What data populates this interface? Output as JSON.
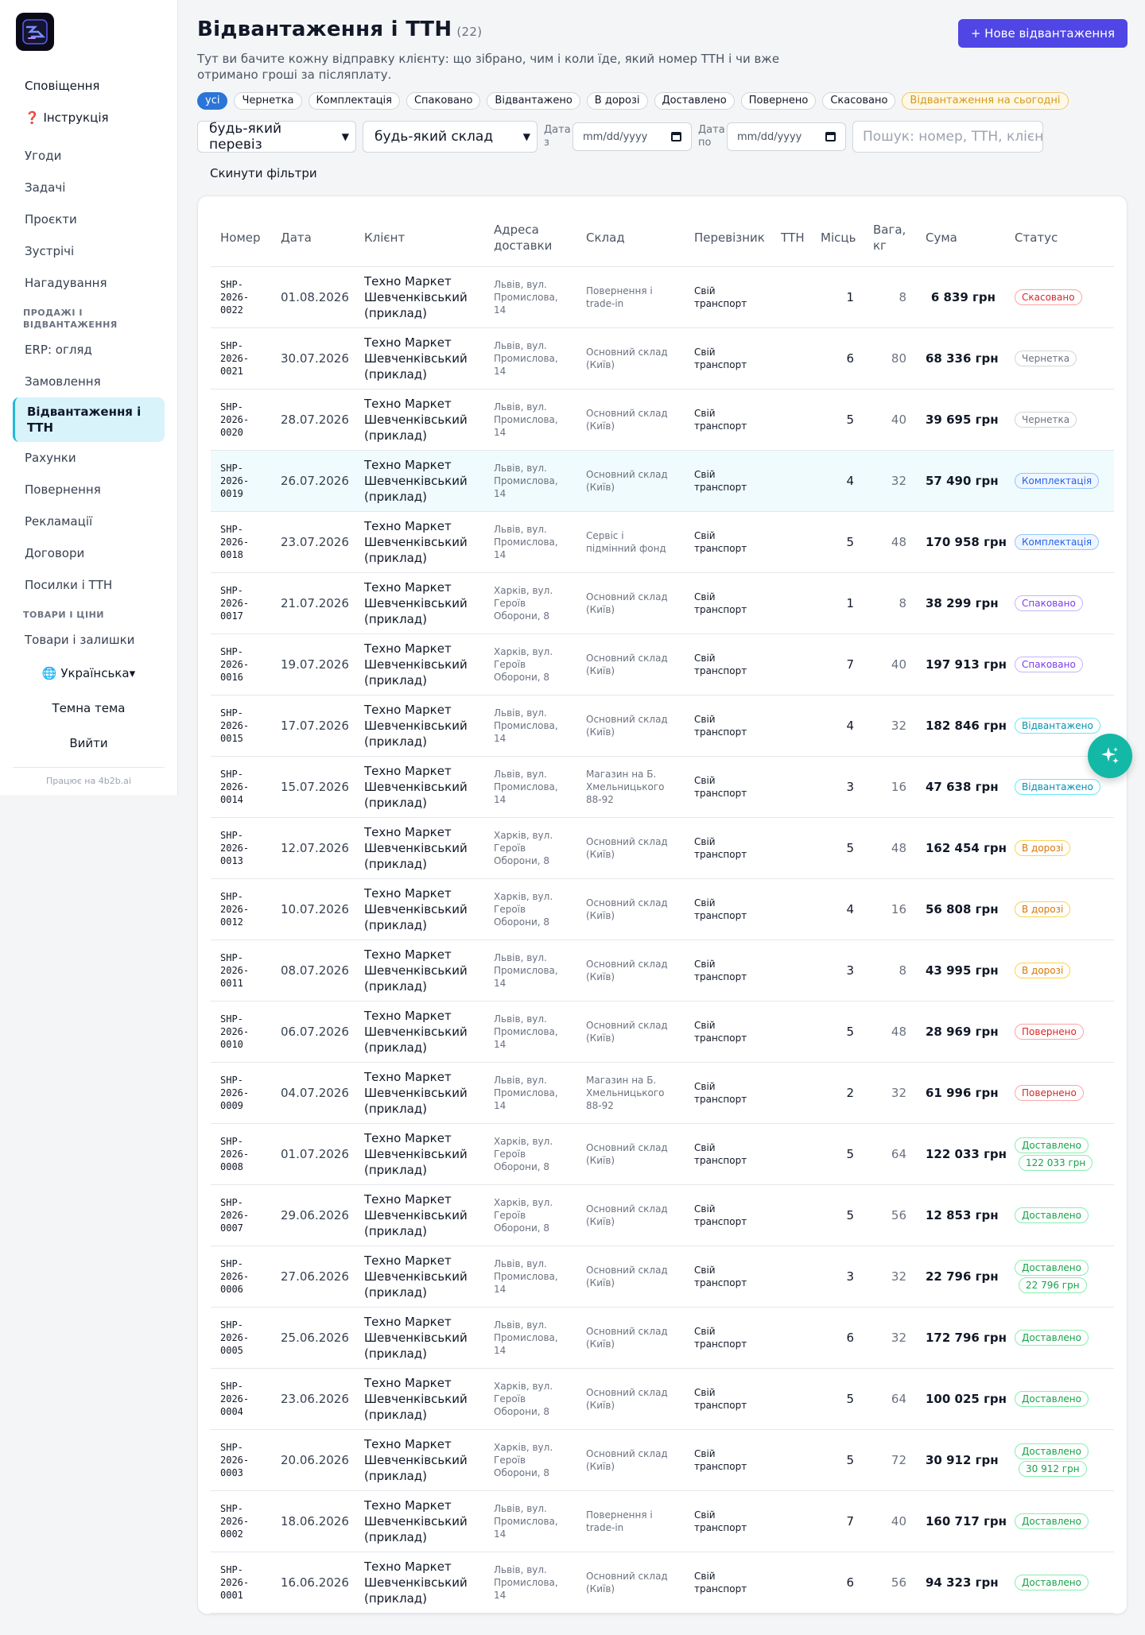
{
  "sidebar": {
    "top": [
      {
        "id": "notifications",
        "label": "Сповіщення"
      },
      {
        "id": "instructions",
        "label": "❓ Інструкція"
      }
    ],
    "main": [
      {
        "id": "deals",
        "label": "Угоди"
      },
      {
        "id": "tasks",
        "label": "Задачі"
      },
      {
        "id": "projects",
        "label": "Проєкти"
      },
      {
        "id": "meetings",
        "label": "Зустрічі"
      },
      {
        "id": "reminders",
        "label": "Нагадування"
      }
    ],
    "sales_section": "ПРОДАЖІ І ВІДВАНТАЖЕННЯ",
    "sales": [
      {
        "id": "erp",
        "label": "ERP: огляд"
      },
      {
        "id": "orders",
        "label": "Замовлення"
      },
      {
        "id": "shipments",
        "label": "Відвантаження і ТТН"
      },
      {
        "id": "invoices",
        "label": "Рахунки"
      },
      {
        "id": "returns",
        "label": "Повернення"
      },
      {
        "id": "claims",
        "label": "Рекламації"
      },
      {
        "id": "contracts",
        "label": "Договори"
      },
      {
        "id": "parcels",
        "label": "Посилки і ТТН"
      }
    ],
    "goods_section": "ТОВАРИ І ЦІНИ",
    "goods": [
      {
        "id": "stock",
        "label": "Товари і залишки"
      }
    ],
    "language": "🌐 Українська▾",
    "theme": "Темна тема",
    "logout": "Вийти",
    "powered": "Працює на 4b2b.ai"
  },
  "header": {
    "title": "Відвантаження і ТТН",
    "count": "(22)",
    "new_button": "+ Нове відвантаження",
    "subtitle": "Тут ви бачите кожну відправку клієнту: що зібрано, чим і коли їде, який номер ТТН і чи вже отримано гроші за післяплату."
  },
  "status_chips": [
    {
      "label": "усі",
      "state": "active"
    },
    {
      "label": "Чернетка",
      "state": ""
    },
    {
      "label": "Комплектація",
      "state": ""
    },
    {
      "label": "Спаковано",
      "state": ""
    },
    {
      "label": "Відвантажено",
      "state": ""
    },
    {
      "label": "В дорозі",
      "state": ""
    },
    {
      "label": "Доставлено",
      "state": ""
    },
    {
      "label": "Повернено",
      "state": ""
    },
    {
      "label": "Скасовано",
      "state": ""
    },
    {
      "label": "Відвантаження на сьогодні",
      "state": "today"
    }
  ],
  "filters": {
    "carrier": "будь-який перевіз",
    "warehouse": "будь-який склад",
    "date_from_label": "Дата з",
    "date_to_label": "Дата по",
    "date_placeholder": "mm/dd/yyyy",
    "search_placeholder": "Пошук: номер, ТТН, клієн",
    "reset": "Скинути фільтри"
  },
  "table": {
    "columns": {
      "number": "Номер",
      "date": "Дата",
      "client": "Клієнт",
      "address": "Адреса доставки",
      "warehouse": "Склад",
      "carrier": "Перевізник",
      "ttn": "ТТН",
      "places": "Місць",
      "weight": "Вага, кг",
      "sum": "Сума",
      "status": "Статус"
    },
    "rows": [
      {
        "number": "SHP-2026-0022",
        "date": "01.08.2026",
        "client": "Техно Маркет Шевченківський (приклад)",
        "address": "Львів, вул. Промислова, 14",
        "warehouse": "Повернення і trade-in",
        "carrier": "Свій транспорт",
        "ttn": "",
        "places": "1",
        "weight": "8",
        "sum": "6 839 грн",
        "status": "Скасовано",
        "status_class": "st-canceled",
        "cod": ""
      },
      {
        "number": "SHP-2026-0021",
        "date": "30.07.2026",
        "client": "Техно Маркет Шевченківський (приклад)",
        "address": "Львів, вул. Промислова, 14",
        "warehouse": "Основний склад (Київ)",
        "carrier": "Свій транспорт",
        "ttn": "",
        "places": "6",
        "weight": "80",
        "sum": "68 336 грн",
        "status": "Чернетка",
        "status_class": "st-draft",
        "cod": ""
      },
      {
        "number": "SHP-2026-0020",
        "date": "28.07.2026",
        "client": "Техно Маркет Шевченківський (приклад)",
        "address": "Львів, вул. Промислова, 14",
        "warehouse": "Основний склад (Київ)",
        "carrier": "Свій транспорт",
        "ttn": "",
        "places": "5",
        "weight": "40",
        "sum": "39 695 грн",
        "status": "Чернетка",
        "status_class": "st-draft",
        "cod": ""
      },
      {
        "number": "SHP-2026-0019",
        "date": "26.07.2026",
        "client": "Техно Маркет Шевченківський (приклад)",
        "address": "Львів, вул. Промислова, 14",
        "warehouse": "Основний склад (Київ)",
        "carrier": "Свій транспорт",
        "ttn": "",
        "places": "4",
        "weight": "32",
        "sum": "57 490 грн",
        "status": "Комплектація",
        "status_class": "st-picking",
        "cod": ""
      },
      {
        "number": "SHP-2026-0018",
        "date": "23.07.2026",
        "client": "Техно Маркет Шевченківський (приклад)",
        "address": "Львів, вул. Промислова, 14",
        "warehouse": "Сервіс і підмінний фонд",
        "carrier": "Свій транспорт",
        "ttn": "",
        "places": "5",
        "weight": "48",
        "sum": "170 958 грн",
        "status": "Комплектація",
        "status_class": "st-picking",
        "cod": ""
      },
      {
        "number": "SHP-2026-0017",
        "date": "21.07.2026",
        "client": "Техно Маркет Шевченківський (приклад)",
        "address": "Харків, вул. Героїв Оборони, 8",
        "warehouse": "Основний склад (Київ)",
        "carrier": "Свій транспорт",
        "ttn": "",
        "places": "1",
        "weight": "8",
        "sum": "38 299 грн",
        "status": "Спаковано",
        "status_class": "st-packed",
        "cod": ""
      },
      {
        "number": "SHP-2026-0016",
        "date": "19.07.2026",
        "client": "Техно Маркет Шевченківський (приклад)",
        "address": "Харків, вул. Героїв Оборони, 8",
        "warehouse": "Основний склад (Київ)",
        "carrier": "Свій транспорт",
        "ttn": "",
        "places": "7",
        "weight": "40",
        "sum": "197 913 грн",
        "status": "Спаковано",
        "status_class": "st-packed",
        "cod": ""
      },
      {
        "number": "SHP-2026-0015",
        "date": "17.07.2026",
        "client": "Техно Маркет Шевченківський (приклад)",
        "address": "Львів, вул. Промислова, 14",
        "warehouse": "Основний склад (Київ)",
        "carrier": "Свій транспорт",
        "ttn": "",
        "places": "4",
        "weight": "32",
        "sum": "182 846 грн",
        "status": "Відвантажено",
        "status_class": "st-shipped",
        "cod": ""
      },
      {
        "number": "SHP-2026-0014",
        "date": "15.07.2026",
        "client": "Техно Маркет Шевченківський (приклад)",
        "address": "Львів, вул. Промислова, 14",
        "warehouse": "Магазин на Б. Хмельницького 88-92",
        "carrier": "Свій транспорт",
        "ttn": "",
        "places": "3",
        "weight": "16",
        "sum": "47 638 грн",
        "status": "Відвантажено",
        "status_class": "st-shipped",
        "cod": ""
      },
      {
        "number": "SHP-2026-0013",
        "date": "12.07.2026",
        "client": "Техно Маркет Шевченківський (приклад)",
        "address": "Харків, вул. Героїв Оборони, 8",
        "warehouse": "Основний склад (Київ)",
        "carrier": "Свій транспорт",
        "ttn": "",
        "places": "5",
        "weight": "48",
        "sum": "162 454 грн",
        "status": "В дорозі",
        "status_class": "st-transit",
        "cod": ""
      },
      {
        "number": "SHP-2026-0012",
        "date": "10.07.2026",
        "client": "Техно Маркет Шевченківський (приклад)",
        "address": "Харків, вул. Героїв Оборони, 8",
        "warehouse": "Основний склад (Київ)",
        "carrier": "Свій транспорт",
        "ttn": "",
        "places": "4",
        "weight": "16",
        "sum": "56 808 грн",
        "status": "В дорозі",
        "status_class": "st-transit",
        "cod": ""
      },
      {
        "number": "SHP-2026-0011",
        "date": "08.07.2026",
        "client": "Техно Маркет Шевченківський (приклад)",
        "address": "Львів, вул. Промислова, 14",
        "warehouse": "Основний склад (Київ)",
        "carrier": "Свій транспорт",
        "ttn": "",
        "places": "3",
        "weight": "8",
        "sum": "43 995 грн",
        "status": "В дорозі",
        "status_class": "st-transit",
        "cod": ""
      },
      {
        "number": "SHP-2026-0010",
        "date": "06.07.2026",
        "client": "Техно Маркет Шевченківський (приклад)",
        "address": "Львів, вул. Промислова, 14",
        "warehouse": "Основний склад (Київ)",
        "carrier": "Свій транспорт",
        "ttn": "",
        "places": "5",
        "weight": "48",
        "sum": "28 969 грн",
        "status": "Повернено",
        "status_class": "st-returned",
        "cod": ""
      },
      {
        "number": "SHP-2026-0009",
        "date": "04.07.2026",
        "client": "Техно Маркет Шевченківський (приклад)",
        "address": "Львів, вул. Промислова, 14",
        "warehouse": "Магазин на Б. Хмельницького 88-92",
        "carrier": "Свій транспорт",
        "ttn": "",
        "places": "2",
        "weight": "32",
        "sum": "61 996 грн",
        "status": "Повернено",
        "status_class": "st-returned",
        "cod": ""
      },
      {
        "number": "SHP-2026-0008",
        "date": "01.07.2026",
        "client": "Техно Маркет Шевченківський (приклад)",
        "address": "Харків, вул. Героїв Оборони, 8",
        "warehouse": "Основний склад (Київ)",
        "carrier": "Свій транспорт",
        "ttn": "",
        "places": "5",
        "weight": "64",
        "sum": "122 033 грн",
        "status": "Доставлено",
        "status_class": "st-delivered",
        "cod": "122 033 грн"
      },
      {
        "number": "SHP-2026-0007",
        "date": "29.06.2026",
        "client": "Техно Маркет Шевченківський (приклад)",
        "address": "Харків, вул. Героїв Оборони, 8",
        "warehouse": "Основний склад (Київ)",
        "carrier": "Свій транспорт",
        "ttn": "",
        "places": "5",
        "weight": "56",
        "sum": "12 853 грн",
        "status": "Доставлено",
        "status_class": "st-delivered",
        "cod": ""
      },
      {
        "number": "SHP-2026-0006",
        "date": "27.06.2026",
        "client": "Техно Маркет Шевченківський (приклад)",
        "address": "Львів, вул. Промислова, 14",
        "warehouse": "Основний склад (Київ)",
        "carrier": "Свій транспорт",
        "ttn": "",
        "places": "3",
        "weight": "32",
        "sum": "22 796 грн",
        "status": "Доставлено",
        "status_class": "st-delivered",
        "cod": "22 796 грн"
      },
      {
        "number": "SHP-2026-0005",
        "date": "25.06.2026",
        "client": "Техно Маркет Шевченківський (приклад)",
        "address": "Львів, вул. Промислова, 14",
        "warehouse": "Основний склад (Київ)",
        "carrier": "Свій транспорт",
        "ttn": "",
        "places": "6",
        "weight": "32",
        "sum": "172 796 грн",
        "status": "Доставлено",
        "status_class": "st-delivered",
        "cod": ""
      },
      {
        "number": "SHP-2026-0004",
        "date": "23.06.2026",
        "client": "Техно Маркет Шевченківський (приклад)",
        "address": "Харків, вул. Героїв Оборони, 8",
        "warehouse": "Основний склад (Київ)",
        "carrier": "Свій транспорт",
        "ttn": "",
        "places": "5",
        "weight": "64",
        "sum": "100 025 грн",
        "status": "Доставлено",
        "status_class": "st-delivered",
        "cod": ""
      },
      {
        "number": "SHP-2026-0003",
        "date": "20.06.2026",
        "client": "Техно Маркет Шевченківський (приклад)",
        "address": "Харків, вул. Героїв Оборони, 8",
        "warehouse": "Основний склад (Київ)",
        "carrier": "Свій транспорт",
        "ttn": "",
        "places": "5",
        "weight": "72",
        "sum": "30 912 грн",
        "status": "Доставлено",
        "status_class": "st-delivered",
        "cod": "30 912 грн"
      },
      {
        "number": "SHP-2026-0002",
        "date": "18.06.2026",
        "client": "Техно Маркет Шевченківський (приклад)",
        "address": "Львів, вул. Промислова, 14",
        "warehouse": "Повернення і trade-in",
        "carrier": "Свій транспорт",
        "ttn": "",
        "places": "7",
        "weight": "40",
        "sum": "160 717 грн",
        "status": "Доставлено",
        "status_class": "st-delivered",
        "cod": ""
      },
      {
        "number": "SHP-2026-0001",
        "date": "16.06.2026",
        "client": "Техно Маркет Шевченківський (приклад)",
        "address": "Львів, вул. Промислова, 14",
        "warehouse": "Основний склад (Київ)",
        "carrier": "Свій транспорт",
        "ttn": "",
        "places": "6",
        "weight": "56",
        "sum": "94 323 грн",
        "status": "Доставлено",
        "status_class": "st-delivered",
        "cod": ""
      }
    ],
    "highlighted_row": 3
  },
  "colors": {
    "accent": "#4f46e5",
    "active_nav": "#d8f3fa",
    "fab": "#14b8a6"
  },
  "icons": {
    "fab": "sparkle-icon",
    "calendar": "calendar-icon",
    "logo": "app-logo-icon"
  }
}
